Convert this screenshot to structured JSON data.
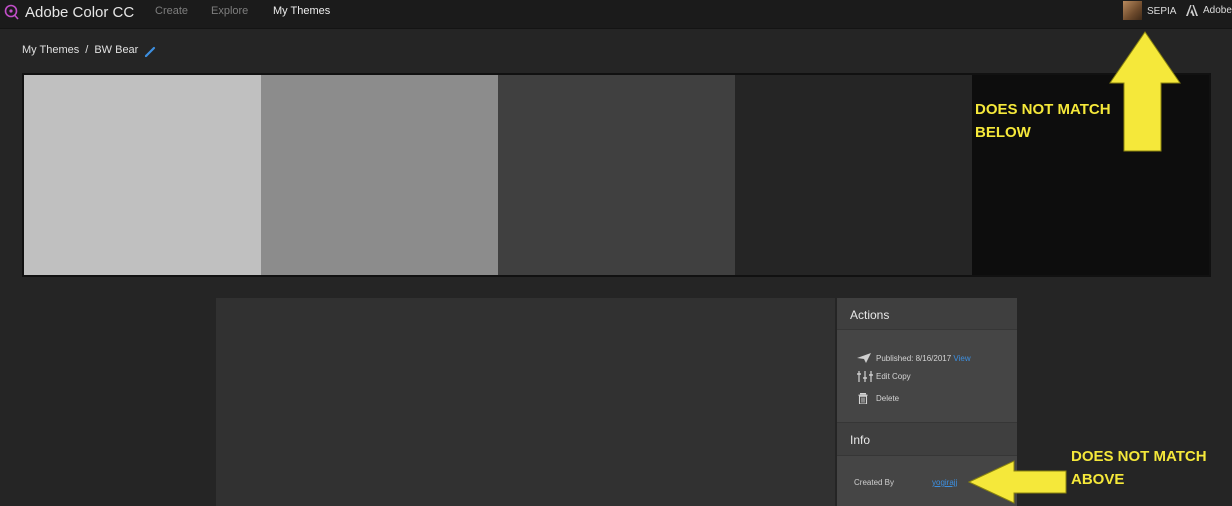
{
  "header": {
    "app_title": "Adobe Color CC",
    "nav": [
      "Create",
      "Explore",
      "My Themes"
    ],
    "active_nav": "My Themes",
    "user_name": "SEPIA",
    "adobe_label": "Adobe"
  },
  "breadcrumb": {
    "root": "My Themes",
    "separator": "/",
    "current": "BW Bear"
  },
  "theme": {
    "swatches": [
      "#c0c0c0",
      "#8c8c8c",
      "#404040",
      "#252525",
      "#0d0d0d"
    ]
  },
  "panel": {
    "actions_title": "Actions",
    "published_label": "Published: 8/16/2017",
    "view_label": "View",
    "edit_copy_label": "Edit Copy",
    "delete_label": "Delete",
    "info_title": "Info",
    "created_by_label": "Created By",
    "created_by_value": "yogirajj"
  },
  "annotations": {
    "top": "DOES NOT MATCH\nBELOW",
    "bottom": "DOES NOT MATCH\nABOVE",
    "color": "#f5e83a"
  },
  "colors": {
    "accent_link": "#3d8fe0",
    "logo_purple": "#c24ec9"
  }
}
